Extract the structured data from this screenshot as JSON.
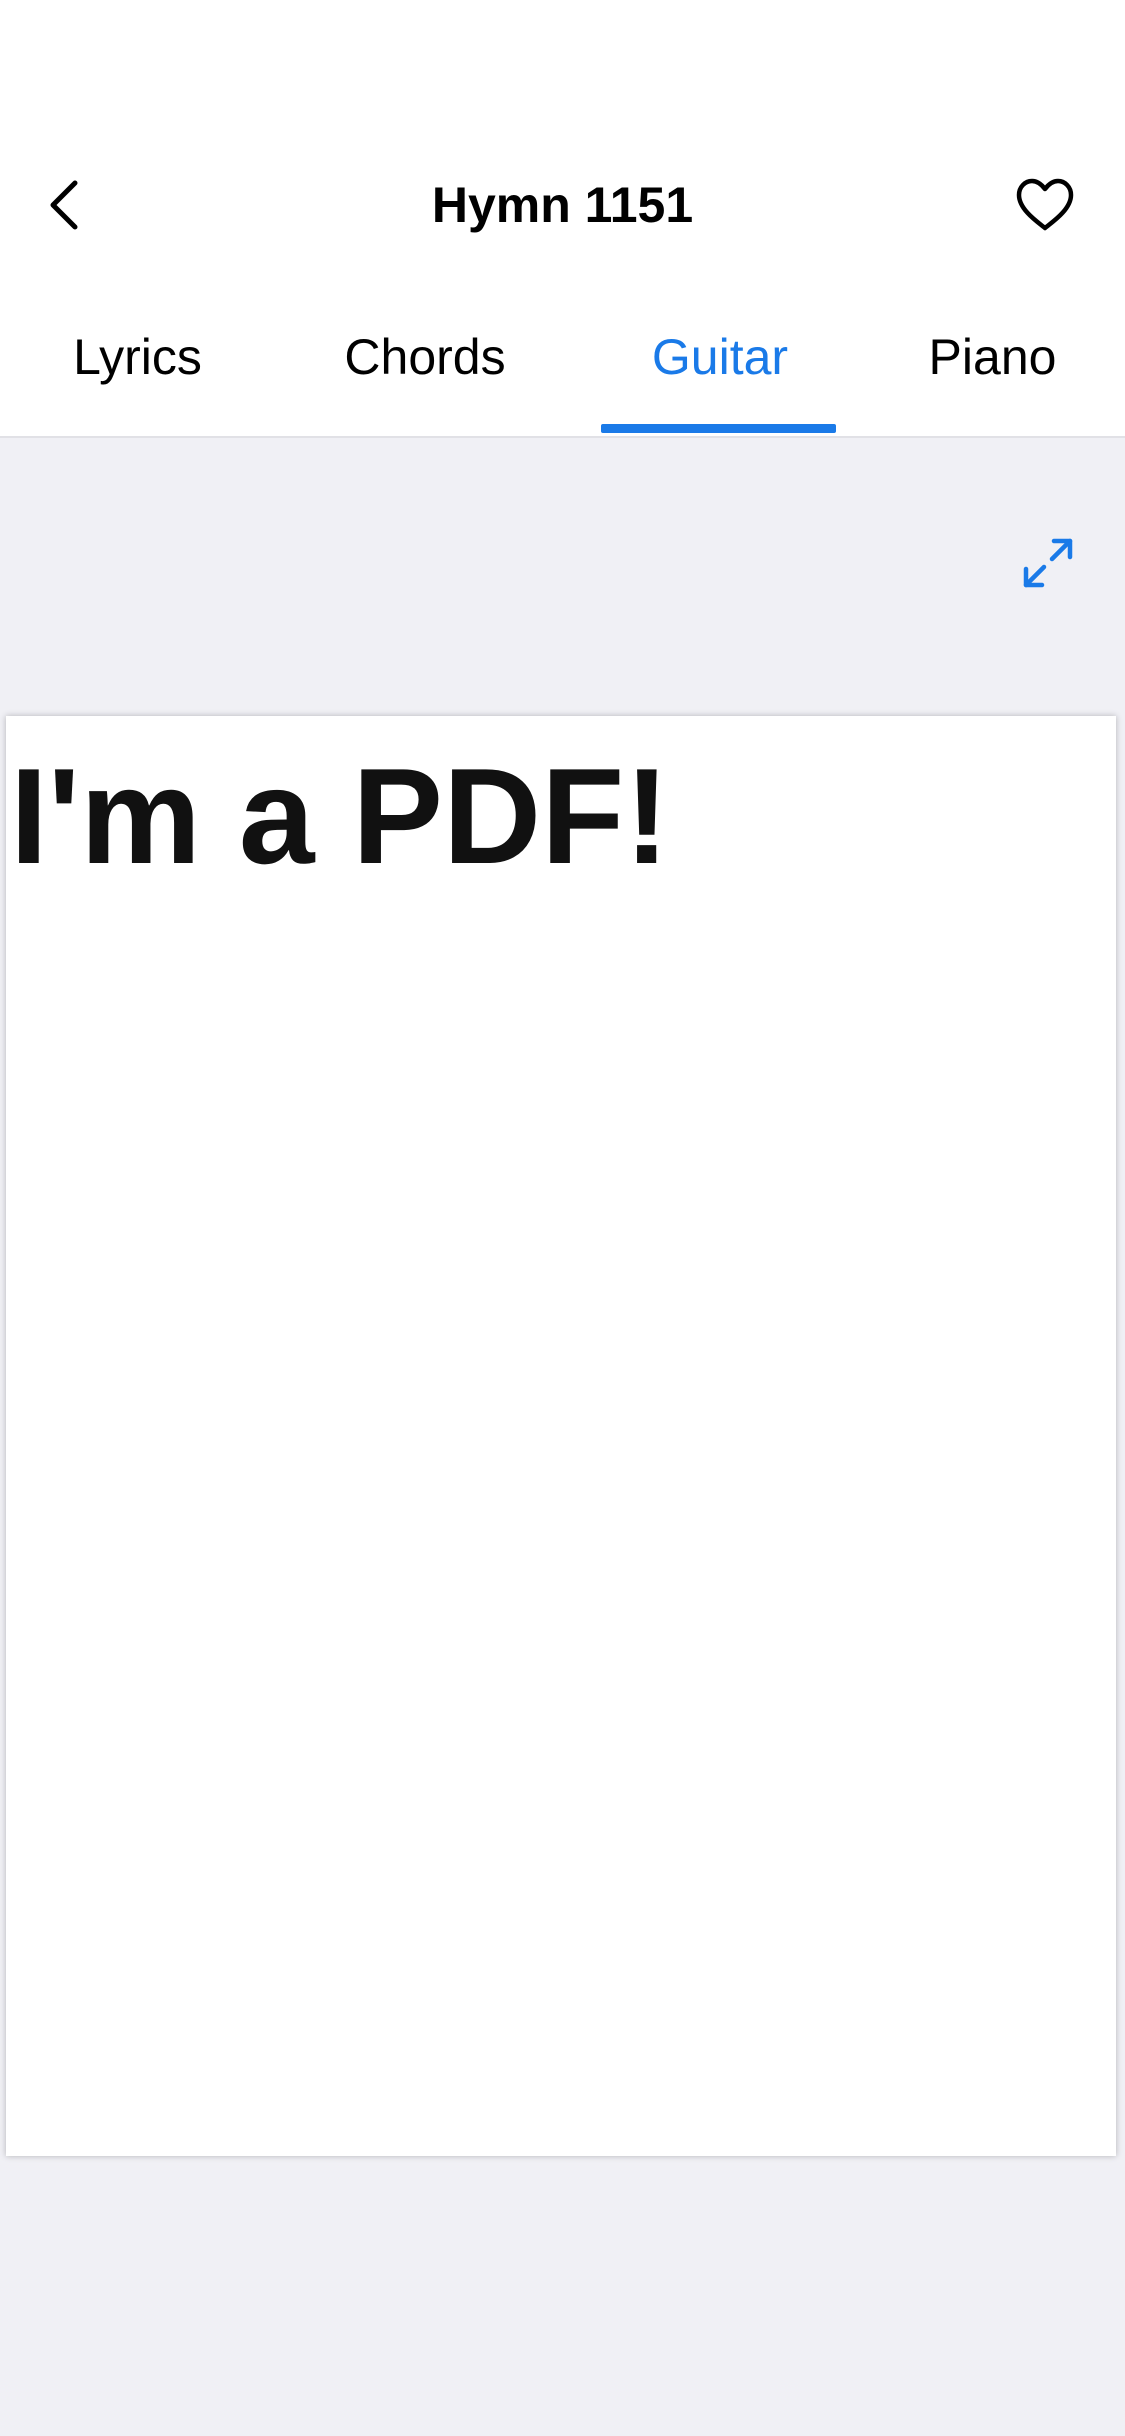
{
  "header": {
    "title": "Hymn 1151",
    "back_icon": "chevron-left-icon",
    "favorite_icon": "heart-outline-icon"
  },
  "tabs": [
    {
      "label": "Lyrics",
      "active": false
    },
    {
      "label": "Chords",
      "active": false
    },
    {
      "label": "Guitar",
      "active": true
    },
    {
      "label": "Piano",
      "active": false
    }
  ],
  "toolbar": {
    "expand_icon": "expand-arrows-icon"
  },
  "document": {
    "text": "I'm a PDF!"
  },
  "colors": {
    "accent": "#1A7AE8",
    "background": "#F0F0F5",
    "surface": "#FFFFFF",
    "text": "#000000"
  }
}
